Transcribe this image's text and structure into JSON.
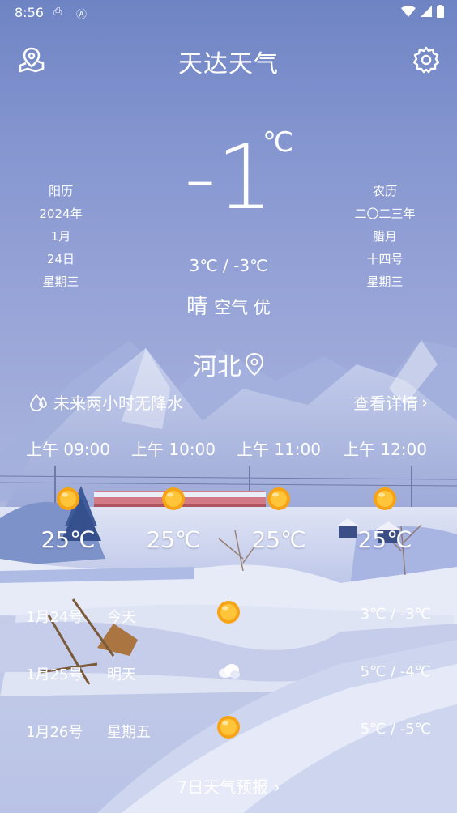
{
  "status": {
    "time": "8:56"
  },
  "header": {
    "title": "天达天气"
  },
  "current": {
    "temp": "-1",
    "unit": "℃",
    "range": "3℃ / -3℃",
    "condition": "晴",
    "air_quality": "空气 优"
  },
  "solar": {
    "label": "阳历",
    "year": "2024年",
    "month": "1月",
    "day": "24日",
    "weekday": "星期三"
  },
  "lunar": {
    "label": "农历",
    "year": "二〇二三年",
    "month": "腊月",
    "day": "十四号",
    "weekday": "星期三"
  },
  "location": {
    "city": "河北"
  },
  "rain": {
    "text": "未来两小时无降水",
    "details_label": "查看详情"
  },
  "hourly": [
    {
      "time": "上午 09:00",
      "icon": "sun-icon",
      "temp": "25℃"
    },
    {
      "time": "上午 10:00",
      "icon": "sun-icon",
      "temp": "25℃"
    },
    {
      "time": "上午 11:00",
      "icon": "sun-icon",
      "temp": "25℃"
    },
    {
      "time": "上午 12:00",
      "icon": "sun-icon",
      "temp": "25℃"
    }
  ],
  "daily": [
    {
      "date": "1月24号",
      "name": "今天",
      "icon": "sun-icon",
      "range": "3℃ / -3℃"
    },
    {
      "date": "1月25号",
      "name": "明天",
      "icon": "cloud-icon",
      "range": "5℃ / -4℃"
    },
    {
      "date": "1月26号",
      "name": "星期五",
      "icon": "sun-icon",
      "range": "5℃ / -5℃"
    }
  ],
  "forecast_link": "7日天气预报",
  "colors": {
    "sun": "#f7a316",
    "sky_top": "#6f84c4",
    "snow": "#eef1fa"
  }
}
